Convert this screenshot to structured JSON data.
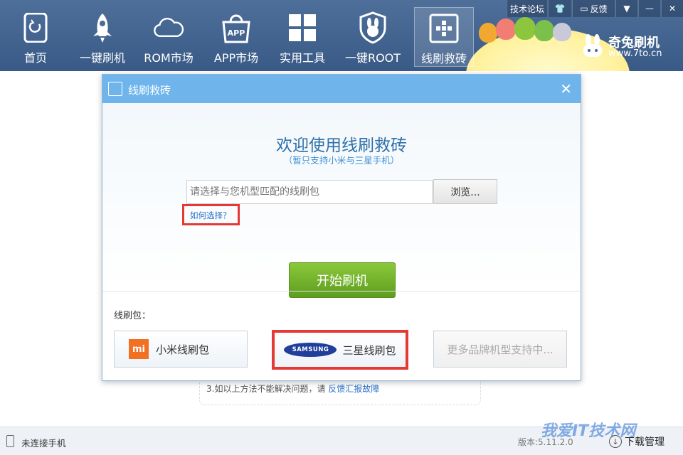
{
  "nav": {
    "items": [
      {
        "label": "首页",
        "icon": "home-icon"
      },
      {
        "label": "一键刷机",
        "icon": "rocket-icon"
      },
      {
        "label": "ROM市场",
        "icon": "cloud-icon"
      },
      {
        "label": "APP市场",
        "icon": "app-bag-icon"
      },
      {
        "label": "实用工具",
        "icon": "grid-icon"
      },
      {
        "label": "一键ROOT",
        "icon": "rabbit-shield-icon"
      },
      {
        "label": "线刷救砖",
        "icon": "plus-box-icon",
        "active": true
      }
    ]
  },
  "top_controls": {
    "forum": "技术论坛",
    "feedback": "反馈"
  },
  "brand": {
    "name": "奇兔刷机",
    "url": "www.7to.cn"
  },
  "dialog": {
    "title": "线刷救砖",
    "welcome": "欢迎使用线刷救砖",
    "subtitle": "（暂只支持小米与三星手机）",
    "file_placeholder": "请选择与您机型匹配的线刷包",
    "browse": "浏览...",
    "how_to_choose": "如何选择？",
    "start": "开始刷机",
    "packages_label": "线刷包：",
    "packages": {
      "xiaomi": "小米线刷包",
      "xiaomi_logo": "mi",
      "samsung": "三星线刷包",
      "samsung_logo": "SAMSUNG",
      "more": "更多品牌机型支持中..."
    }
  },
  "tip": {
    "text": "3.如以上方法不能解决问题，请",
    "link": "反馈汇报故障"
  },
  "status": {
    "connection": "未连接手机",
    "version": "版本:5.11.2.0",
    "download": "下载管理",
    "watermark": "我爱IT技术网"
  },
  "colors": {
    "topbar": "#4a6a95",
    "dialog_header": "#6fb5ec",
    "start_button": "#6aab27",
    "highlight": "#e53935",
    "link": "#2a6fc9"
  }
}
